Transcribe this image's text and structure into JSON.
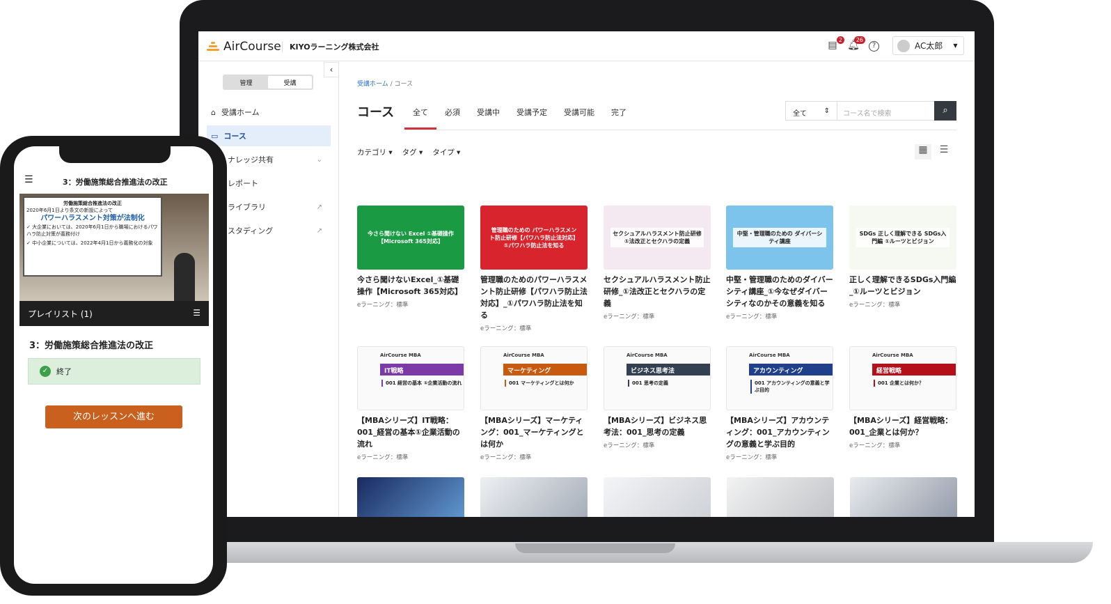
{
  "header": {
    "brand": "AirCourse",
    "company": "KIYOラーニング株式会社",
    "clipboard_badge": "2",
    "bell_badge": "26",
    "user_name": "AC太郎"
  },
  "sidebar": {
    "toggle": [
      "管理",
      "受講"
    ],
    "items": [
      {
        "label": "受講ホーム",
        "icon": "home-icon"
      },
      {
        "label": "コース",
        "icon": "monitor-icon"
      },
      {
        "label": "ナレッジ共有",
        "icon": "chevron-down-icon"
      },
      {
        "label": "レポート"
      },
      {
        "label": "ライブラリ",
        "icon": "external-link-icon"
      },
      {
        "label": "スタディング",
        "icon": "external-link-icon"
      }
    ]
  },
  "breadcrumb": {
    "home": "受講ホーム",
    "current": "コース"
  },
  "main": {
    "title": "コース",
    "tabs": [
      "全て",
      "必須",
      "受講中",
      "受講予定",
      "受講可能",
      "完了"
    ],
    "select_value": "全て",
    "search_placeholder": "コース名で検索",
    "filters": [
      "カテゴリ",
      "タグ",
      "タイプ"
    ]
  },
  "courses": [
    {
      "thumb": "今さら聞けない Excel ①基礎操作【Microsoft 365対応】",
      "title": "今さら聞けないExcel_①基礎操作【Microsoft 365対応】",
      "meta": "eラーニング：標準",
      "color": "#1a9b43"
    },
    {
      "thumb": "管理職のための パワーハラスメント防止研修【パワハラ防止法対応】①パワハラ防止法を知る",
      "title": "管理職のためのパワーハラスメント防止研修【パワハラ防止法対応】_①パワハラ防止法を知る",
      "meta": "eラーニング：標準",
      "color": "#d8242c"
    },
    {
      "thumb": "セクシュアルハラスメント防止研修 ①法改正とセクハラの定義",
      "title": "セクシュアルハラスメント防止研修_①法改正とセクハラの定義",
      "meta": "eラーニング：標準",
      "color": "#f4e9f0"
    },
    {
      "thumb": "中堅・管理職のための ダイバーシティ講座",
      "title": "中堅・管理職のためのダイバーシティ講座_①今なぜダイバーシティなのかその意義を知る",
      "meta": "eラーニング：標準",
      "color": "#7cc4ec"
    },
    {
      "thumb": "SDGs 正しく理解できる SDGs入門編 ①ルーツとビジョン",
      "title": "正しく理解できるSDGs入門編_①ルーツとビジョン",
      "meta": "eラーニング：標準",
      "color": "#f6f8f2"
    },
    {
      "brand": "AirCourse MBA",
      "bar": "IT戦略",
      "num": "001 経営の基本 ①企業活動の流れ",
      "title": "【MBAシリーズ】IT戦略：001_経営の基本①企業活動の流れ",
      "meta": "eラーニング：標準",
      "color": "#7b3aa6"
    },
    {
      "brand": "AirCourse MBA",
      "bar": "マーケティング",
      "num": "001 マーケティングとは何か",
      "title": "【MBAシリーズ】マーケティング：001_マーケティングとは何か",
      "meta": "eラーニング：標準",
      "color": "#c85a10"
    },
    {
      "brand": "AirCourse MBA",
      "bar": "ビジネス思考法",
      "num": "001 思考の定義",
      "title": "【MBAシリーズ】ビジネス思考法：001_思考の定義",
      "meta": "eラーニング：標準",
      "color": "#334052"
    },
    {
      "brand": "AirCourse MBA",
      "bar": "アカウンティング",
      "num": "001 アカウンティングの意義と学ぶ目的",
      "title": "【MBAシリーズ】アカウンティング：001_アカウンティングの意義と学ぶ目的",
      "meta": "eラーニング：標準",
      "color": "#1f3f8a"
    },
    {
      "brand": "AirCourse MBA",
      "bar": "経営戦略",
      "num": "001 企業とは何か？",
      "title": "【MBAシリーズ】経営戦略：001_企業とは何か？",
      "meta": "eラーニング：標準",
      "color": "#b4101a"
    }
  ],
  "phone": {
    "title": "3：労働施策総合推進法の改正",
    "slide": {
      "heading": "労働施策総合推進法の改正",
      "line1": "2020年6月1日より条文の新設によって",
      "headline": "パワーハラスメント対策が法制化",
      "bullet1": "✓ 大企業においては、2020年6月1日から職場におけるパワハラ防止対策が義務付け",
      "bullet2": "✓ 中小企業については、2022年4月1日から義務化の対象"
    },
    "playlist": "プレイリスト (1)",
    "lesson_title": "3：労働施策総合推進法の改正",
    "status": "終了",
    "next_button": "次のレッスンへ進む"
  }
}
